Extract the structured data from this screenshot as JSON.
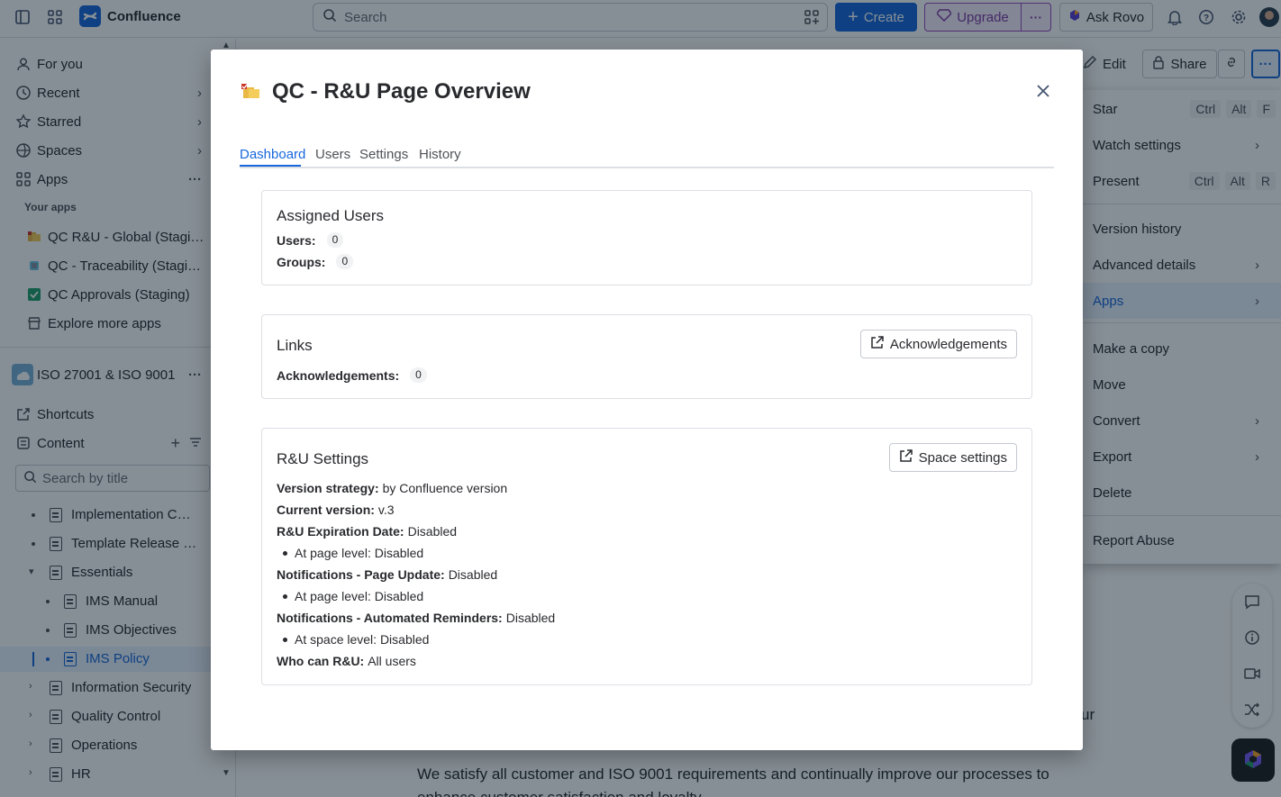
{
  "topbar": {
    "app_name": "Confluence",
    "search_placeholder": "Search",
    "create_label": "Create",
    "upgrade_label": "Upgrade",
    "ask_rovo_label": "Ask Rovo"
  },
  "sidebar": {
    "nav": [
      {
        "label": "For you"
      },
      {
        "label": "Recent"
      },
      {
        "label": "Starred"
      },
      {
        "label": "Spaces"
      },
      {
        "label": "Apps"
      }
    ],
    "your_apps_heading": "Your apps",
    "apps": [
      {
        "label": "QC R&U - Global (Staging)"
      },
      {
        "label": "QC - Traceability (Staging)"
      },
      {
        "label": "QC Approvals (Staging)"
      },
      {
        "label": "Explore more apps"
      }
    ],
    "space_name": "ISO 27001 & ISO 9001",
    "shortcuts_label": "Shortcuts",
    "content_label": "Content",
    "search_title_placeholder": "Search by title",
    "tree": [
      {
        "label": "Implementation Checklist"
      },
      {
        "label": "Template Release Notes"
      },
      {
        "label": "Essentials"
      },
      {
        "label": "IMS Manual"
      },
      {
        "label": "IMS Objectives"
      },
      {
        "label": "IMS Policy"
      },
      {
        "label": "Information Security"
      },
      {
        "label": "Quality Control"
      },
      {
        "label": "Operations"
      },
      {
        "label": "HR"
      }
    ]
  },
  "page_actions": {
    "edit_label": "Edit",
    "share_label": "Share"
  },
  "menu": {
    "items": [
      {
        "label": "Star",
        "keys": [
          "Ctrl",
          "Alt",
          "F"
        ]
      },
      {
        "label": "Watch settings"
      },
      {
        "label": "Present",
        "keys": [
          "Ctrl",
          "Alt",
          "R"
        ]
      },
      {
        "label": "Version history"
      },
      {
        "label": "Advanced details"
      },
      {
        "label": "Apps"
      },
      {
        "label": "Make a copy"
      },
      {
        "label": "Move"
      },
      {
        "label": "Convert"
      },
      {
        "label": "Export"
      },
      {
        "label": "Delete"
      },
      {
        "label": "Report Abuse"
      }
    ]
  },
  "page_content": {
    "line1": "We satisfy all customer and ISO 9001 requirements and continually improve our processes to",
    "line2": "enhance customer satisfaction and loyalty.",
    "fragment": "ur"
  },
  "modal": {
    "title": "QC - R&U Page Overview",
    "tabs": [
      {
        "label": "Dashboard"
      },
      {
        "label": "Users"
      },
      {
        "label": "Settings"
      },
      {
        "label": "History"
      }
    ],
    "assigned_users": {
      "heading": "Assigned Users",
      "users_label": "Users:",
      "users_count": "0",
      "groups_label": "Groups:",
      "groups_count": "0"
    },
    "links": {
      "heading": "Links",
      "button_label": "Acknowledgements",
      "ack_label": "Acknowledgements:",
      "ack_count": "0"
    },
    "settings": {
      "heading": "R&U Settings",
      "button_label": "Space settings",
      "version_strategy_label": "Version strategy:",
      "version_strategy_value": "by Confluence version",
      "current_version_label": "Current version:",
      "current_version_value": "v.3",
      "expiration_label": "R&U Expiration Date:",
      "expiration_value": "Disabled",
      "expiration_sub": "At page level: Disabled",
      "notif_update_label": "Notifications - Page Update:",
      "notif_update_value": "Disabled",
      "notif_update_sub": "At page level: Disabled",
      "notif_reminders_label": "Notifications - Automated Reminders:",
      "notif_reminders_value": "Disabled",
      "notif_reminders_sub": "At space level: Disabled",
      "who_label": "Who can R&U:",
      "who_value": "All users"
    }
  },
  "colors": {
    "accent": "#1868db",
    "upgrade": "#803fa5",
    "overlay": "#051524"
  }
}
